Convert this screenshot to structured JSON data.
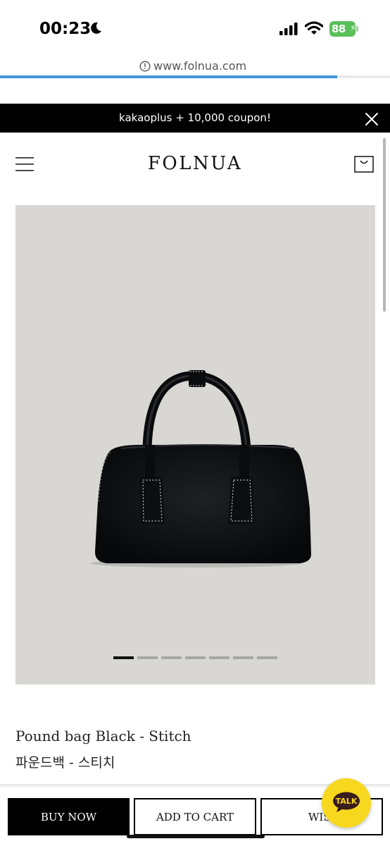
{
  "status_bar": {
    "time": "00:23",
    "battery": "88"
  },
  "browser": {
    "url": "www.folnua.com",
    "load_progress": 0.865
  },
  "banner": {
    "text": "kakaoplus + 10,000 coupon!"
  },
  "header": {
    "logo": "FOLNUA"
  },
  "product": {
    "name": "Pound bag Black - Stitch",
    "name_ko": "파운드백 - 스티치",
    "image_count": 7,
    "current_image": 1
  },
  "actions": {
    "buy_now": "BUY NOW",
    "add_to_cart": "ADD TO CART",
    "wishlist": "WISH",
    "talk": "TALK"
  },
  "colors": {
    "accent_black": "#000000",
    "talk_yellow": "#f7d81e",
    "image_background": "#d8d7d3"
  },
  "icons": [
    "moon-icon",
    "signal-icon",
    "wifi-icon",
    "info-icon",
    "close-icon",
    "menu-icon",
    "cart-icon",
    "talk-bubble-icon"
  ]
}
